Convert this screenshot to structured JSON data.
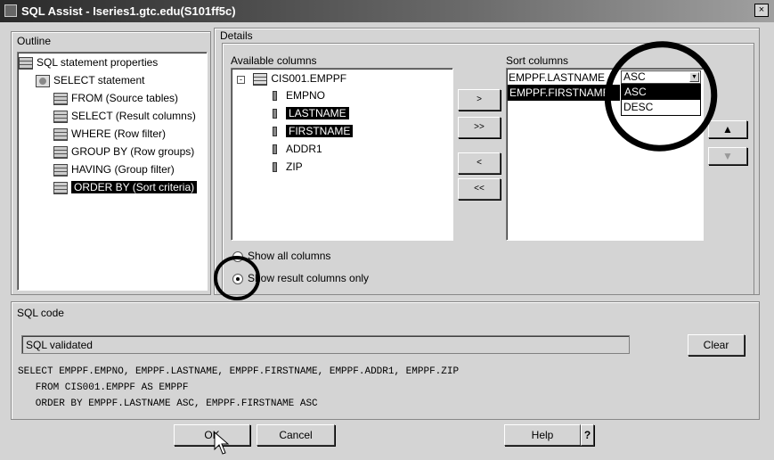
{
  "window": {
    "title": "SQL Assist - Iseries1.gtc.edu(S101ff5c)",
    "close": "×"
  },
  "outline": {
    "label": "Outline",
    "items": [
      {
        "label": "SQL statement properties",
        "icon": "sql-icon"
      },
      {
        "label": "SELECT statement",
        "icon": "magnifier-icon"
      },
      {
        "label": "FROM (Source tables)",
        "icon": "table-icon"
      },
      {
        "label": "SELECT (Result columns)",
        "icon": "table-icon"
      },
      {
        "label": "WHERE (Row filter)",
        "icon": "table-icon"
      },
      {
        "label": "GROUP BY (Row groups)",
        "icon": "table-icon"
      },
      {
        "label": "HAVING (Group filter)",
        "icon": "table-icon"
      },
      {
        "label": "ORDER BY (Sort criteria)",
        "icon": "sort-icon",
        "selected": true
      }
    ]
  },
  "details": {
    "label": "Details",
    "available": {
      "label": "Available columns",
      "table": "CIS001.EMPPF",
      "columns": [
        {
          "name": "EMPNO",
          "selected": false
        },
        {
          "name": "LASTNAME",
          "selected": true
        },
        {
          "name": "FIRSTNAME",
          "selected": true
        },
        {
          "name": "ADDR1",
          "selected": false
        },
        {
          "name": "ZIP",
          "selected": false
        }
      ]
    },
    "move_buttons": [
      ">",
      ">>",
      "<",
      "<<"
    ],
    "sort": {
      "label": "Sort columns",
      "rows": [
        {
          "column": "EMPPF.LASTNAME",
          "order": "ASC"
        },
        {
          "column": "EMPPF.FIRSTNAME",
          "order": ""
        }
      ],
      "dropdown_options": [
        "ASC",
        "DESC"
      ],
      "highlighted": "ASC"
    },
    "radios": [
      {
        "label": "Show all columns",
        "checked": false
      },
      {
        "label": "Show result columns only",
        "checked": true
      }
    ]
  },
  "sql": {
    "label": "SQL code",
    "status": "SQL validated",
    "clear": "Clear",
    "lines": [
      "SELECT EMPPF.EMPNO, EMPPF.LASTNAME, EMPPF.FIRSTNAME, EMPPF.ADDR1, EMPPF.ZIP",
      "   FROM CIS001.EMPPF AS EMPPF",
      "   ORDER BY EMPPF.LASTNAME ASC, EMPPF.FIRSTNAME ASC"
    ]
  },
  "footer": {
    "ok": "OK",
    "cancel": "Cancel",
    "help": "Help",
    "question": "?"
  }
}
